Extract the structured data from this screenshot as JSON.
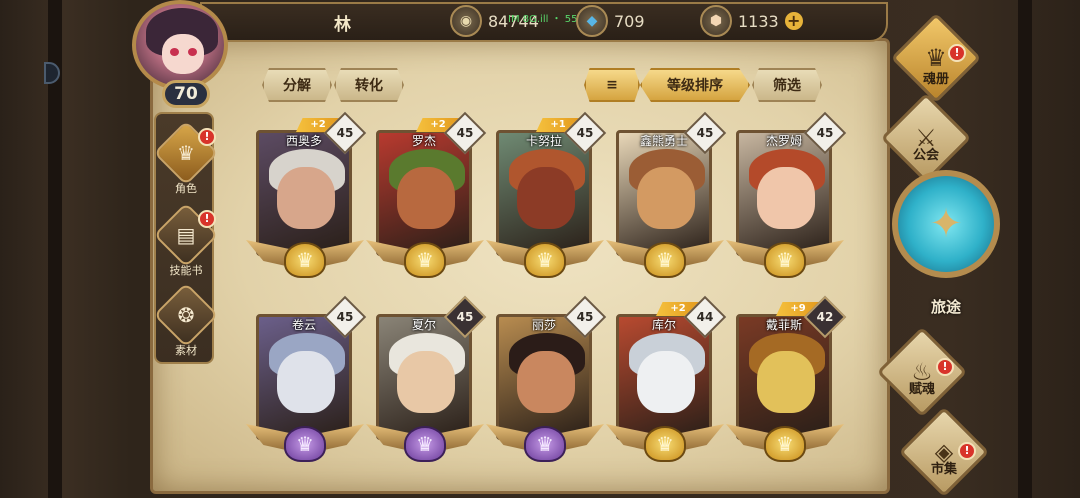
{
  "player": {
    "name": "林",
    "level": "70"
  },
  "resources": [
    {
      "icon": "coin-icon",
      "value": "84744"
    },
    {
      "icon": "crystal-icon",
      "value": "709"
    },
    {
      "icon": "diamond-icon",
      "value": "1133"
    }
  ],
  "notification": "IM 8G.ill ・ 55 B| 02",
  "left_menu": [
    {
      "label": "角色",
      "badge": "!"
    },
    {
      "label": "技能书",
      "badge": "!"
    },
    {
      "label": "素材",
      "badge": ""
    }
  ],
  "actions": {
    "decompose": "分解",
    "convert": "转化",
    "sort_by_level": "等级排序",
    "filter": "筛选"
  },
  "heroes": [
    {
      "name": "西奥多",
      "level": "45",
      "plus": "+2",
      "rarity": "gold",
      "skin": "#d7a68b",
      "hair": "#d7d3cc",
      "bg": "#5c4b63"
    },
    {
      "name": "罗杰",
      "level": "45",
      "plus": "+2",
      "rarity": "gold",
      "skin": "#b8693f",
      "hair": "#5a7a2e",
      "bg": "#b83a2f"
    },
    {
      "name": "卡努拉",
      "level": "45",
      "plus": "+1",
      "rarity": "gold",
      "skin": "#8c3b26",
      "hair": "#b0562e",
      "bg": "#6f8a73"
    },
    {
      "name": "鑫熊勇士",
      "level": "45",
      "plus": "",
      "rarity": "gold",
      "skin": "#d39a62",
      "hair": "#9b5d35",
      "bg": "#e8d7b8"
    },
    {
      "name": "杰罗姆",
      "level": "45",
      "plus": "",
      "rarity": "gold",
      "skin": "#f0c6aa",
      "hair": "#b44a2a",
      "bg": "#c7b6a0"
    },
    {
      "name": "卷云",
      "level": "45",
      "plus": "",
      "rarity": "purple",
      "skin": "#dfe2ea",
      "hair": "#9aa6c4",
      "bg": "#6b5f8a"
    },
    {
      "name": "夏尔",
      "level": "45",
      "plus": "",
      "rarity": "purple",
      "skin": "#e8c8a6",
      "hair": "#e9e6dd",
      "bg": "#8a8477"
    },
    {
      "name": "丽莎",
      "level": "45",
      "plus": "",
      "rarity": "purple",
      "skin": "#c9875f",
      "hair": "#2b1c18",
      "bg": "#b88c50"
    },
    {
      "name": "库尔",
      "level": "44",
      "plus": "+2",
      "rarity": "gold",
      "skin": "#eef0f2",
      "hair": "#c9d0d8",
      "bg": "#b84a30"
    },
    {
      "name": "戴菲斯",
      "level": "42",
      "plus": "+9",
      "rarity": "gold",
      "skin": "#e2c15a",
      "hair": "#a56a24",
      "bg": "#7a3a25"
    }
  ],
  "right_menu": {
    "soul_book": "魂册",
    "guild": "公会",
    "journey": "旅途",
    "fu_soul": "赋魂",
    "market": "市集"
  }
}
